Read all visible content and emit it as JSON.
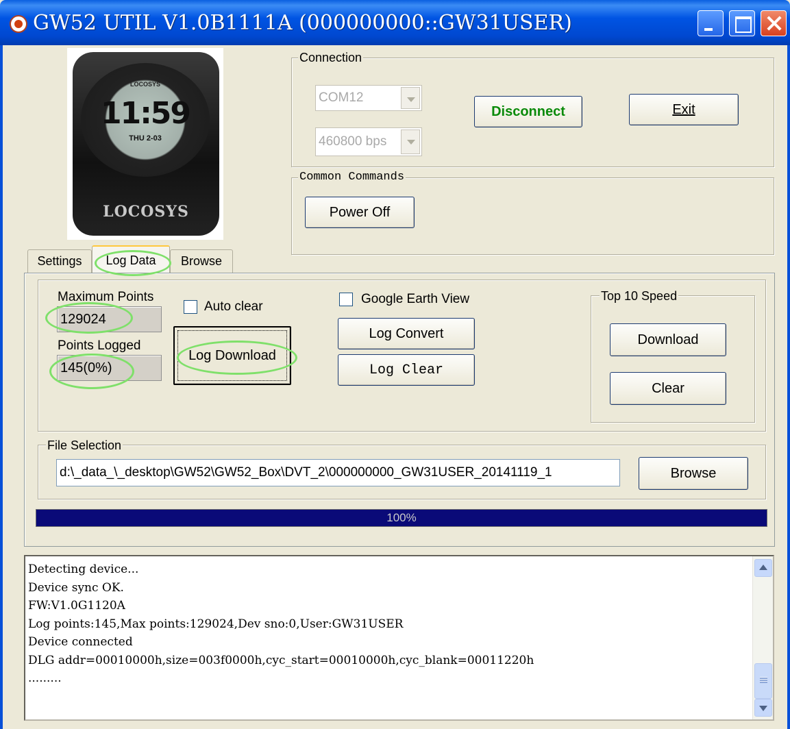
{
  "window": {
    "title": "GW52 UTIL V1.0B1111A (000000000::GW31USER)"
  },
  "device_image": {
    "brand": "LOCOSYS",
    "time": "11:59",
    "date": "THU 2-03"
  },
  "connection": {
    "legend": "Connection",
    "port": "COM12",
    "baud": "460800 bps",
    "disconnect_label": "Disconnect",
    "exit_label": "Exit"
  },
  "common_commands": {
    "legend": "Common Commands",
    "power_off_label": "Power Off"
  },
  "tabs": [
    {
      "label": "Settings",
      "active": false
    },
    {
      "label": "Log Data",
      "active": true
    },
    {
      "label": "Browse",
      "active": false
    }
  ],
  "log_data": {
    "max_points_label": "Maximum Points",
    "max_points_value": "129024",
    "points_logged_label": "Points Logged",
    "points_logged_value": "145(0%)",
    "auto_clear_label": "Auto clear",
    "log_download_label": "Log Download",
    "google_earth_label": "Google Earth View",
    "log_convert_label": "Log Convert",
    "log_clear_label": "Log Clear",
    "top10": {
      "legend": "Top 10 Speed",
      "download_label": "Download",
      "clear_label": "Clear"
    }
  },
  "file_selection": {
    "legend": "File Selection",
    "path": "d:\\_data_\\_desktop\\GW52\\GW52_Box\\DVT_2\\000000000_GW31USER_20141119_1",
    "browse_label": "Browse"
  },
  "progress": {
    "percent": 100,
    "label": "100%"
  },
  "console": {
    "lines": [
      "Detecting device...",
      "Device sync OK.",
      "FW:V1.0G1120A",
      "Log points:145,Max points:129024,Dev sno:0,User:GW31USER",
      "Device connected",
      "DLG addr=00010000h,size=003f0000h,cyc_start=00010000h,cyc_blank=00011220h",
      "........."
    ]
  },
  "colors": {
    "title_bar": "#0054e3",
    "progress_fill": "#0a0a78",
    "highlight": "#7fe06a",
    "disconnect_text": "#0a8a0a"
  }
}
